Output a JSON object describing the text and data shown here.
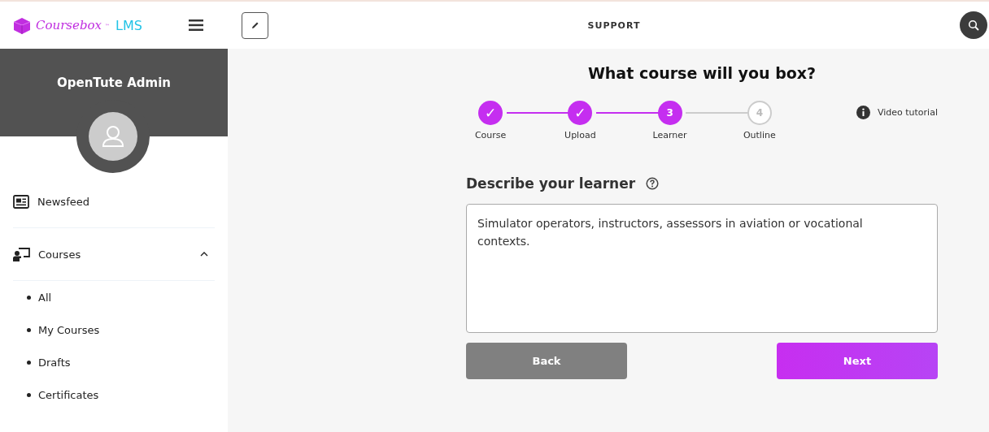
{
  "header": {
    "logo": {
      "name": "Coursebox",
      "tm": "™",
      "suffix": "LMS"
    },
    "title": "SUPPORT"
  },
  "sidebar": {
    "user": "OpenTute Admin",
    "items": [
      {
        "label": "Newsfeed",
        "kind": "news"
      },
      {
        "label": "Courses",
        "kind": "courses",
        "expanded": true,
        "children": [
          {
            "label": "All"
          },
          {
            "label": "My Courses"
          },
          {
            "label": "Drafts"
          },
          {
            "label": "Certificates"
          }
        ]
      }
    ]
  },
  "wizard": {
    "title": "What course will you box?",
    "steps": [
      {
        "label": "Course",
        "marker": "✓",
        "kind": "done"
      },
      {
        "label": "Upload",
        "marker": "✓",
        "kind": "done"
      },
      {
        "label": "Learner",
        "marker": "3",
        "kind": "current"
      },
      {
        "label": "Outline",
        "marker": "4",
        "kind": "upcoming"
      }
    ],
    "video_link": "Video tutorial",
    "field": {
      "label": "Describe your learner",
      "value": "Simulator operators, instructors, assessors in aviation or vocational contexts."
    },
    "buttons": [
      {
        "label": "Back",
        "kind": "secondary"
      },
      {
        "label": "Next",
        "kind": "primary"
      }
    ]
  }
}
